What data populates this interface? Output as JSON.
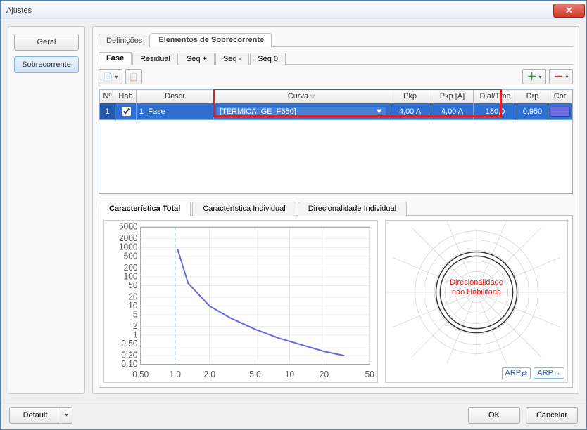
{
  "window": {
    "title": "Ajustes"
  },
  "nav": {
    "geral": "Geral",
    "sobrecorrente": "Sobrecorrente"
  },
  "tabs": {
    "definicoes": "Definições",
    "elementos": "Elementos de Sobrecorrente"
  },
  "subtabs": {
    "fase": "Fase",
    "residual": "Residual",
    "seqp": "Seq +",
    "seqn": "Seq -",
    "seq0": "Seq 0"
  },
  "grid": {
    "headers": {
      "no": "Nº",
      "hab": "Hab",
      "descr": "Descr",
      "curva": "Curva",
      "pkp": "Pkp",
      "pkpa": "Pkp [A]",
      "dialtmp": "Dial/Tmp",
      "drp": "Drp",
      "cor": "Cor"
    },
    "rows": [
      {
        "no": "1",
        "hab": true,
        "descr": "1_Fase",
        "curva": "[TÉRMICA_GE_F650]",
        "pkp": "4,00 A",
        "pkpa": "4,00 A",
        "dialtmp": "180,0",
        "drp": "0,950",
        "cor": "#6b6bdd"
      }
    ]
  },
  "charTabs": {
    "total": "Característica Total",
    "individual": "Característica Individual",
    "direc": "Direcionalidade Individual"
  },
  "polarOverlay": {
    "line1": "Direcionalidade",
    "line2": "não Habilitada"
  },
  "arp": "ARP",
  "footer": {
    "default": "Default",
    "ok": "OK",
    "cancel": "Cancelar"
  },
  "chart_data": {
    "type": "line",
    "title": "",
    "xlabel": "",
    "ylabel": "",
    "xscale": "log",
    "yscale": "log",
    "xlim": [
      0.5,
      50
    ],
    "ylim": [
      0.1,
      5000
    ],
    "xticks": [
      0.5,
      1.0,
      2.0,
      5.0,
      10,
      20,
      50
    ],
    "yticks": [
      0.1,
      0.2,
      0.5,
      1.0,
      2.0,
      5.0,
      10,
      20,
      50,
      100,
      200,
      500,
      1000,
      2000,
      5000
    ],
    "series": [
      {
        "name": "1_Fase",
        "x": [
          1.05,
          1.3,
          2.0,
          3.0,
          5.0,
          8.0,
          12.0,
          20.0,
          30.0
        ],
        "y": [
          900,
          60,
          10,
          4,
          1.6,
          0.8,
          0.5,
          0.28,
          0.2
        ],
        "color": "#6b6bdd"
      }
    ],
    "vlines": [
      1.0
    ]
  }
}
